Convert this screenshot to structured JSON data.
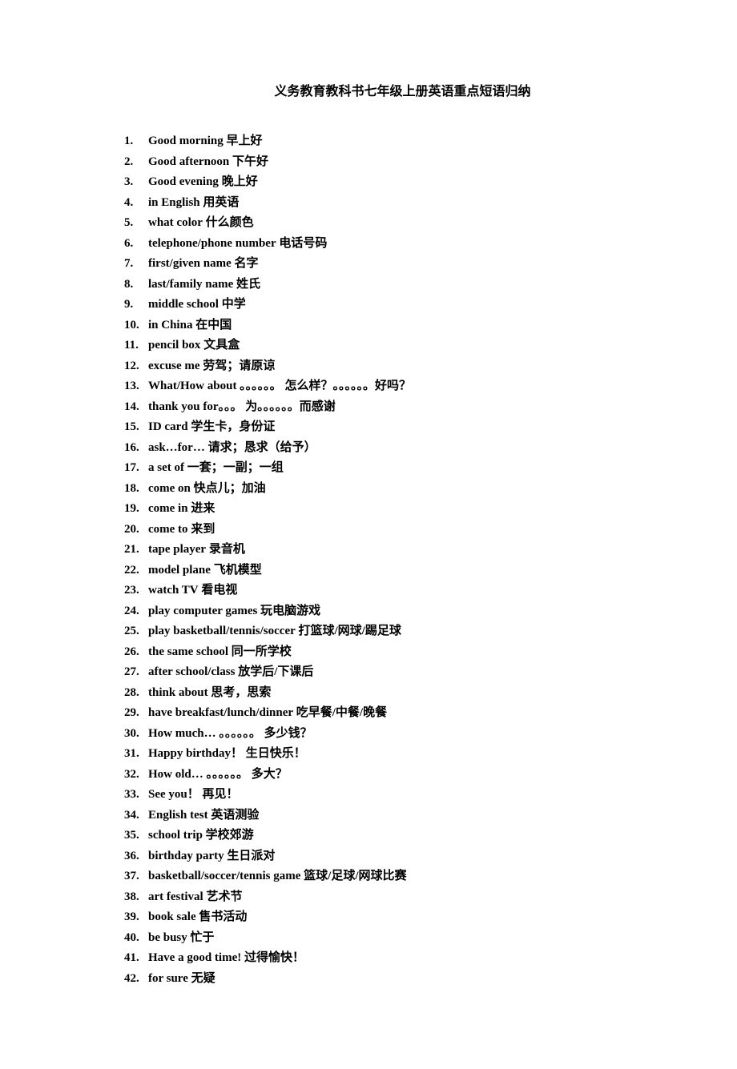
{
  "title": "义务教育教科书七年级上册英语重点短语归纳",
  "items": [
    {
      "en": "Good morning",
      "zh": "早上好"
    },
    {
      "en": "Good afternoon",
      "zh": "下午好"
    },
    {
      "en": "Good evening",
      "zh": "晚上好"
    },
    {
      "en": "in English",
      "zh": "用英语"
    },
    {
      "en": "what color",
      "zh": "什么颜色"
    },
    {
      "en": "telephone/phone number",
      "zh": "电话号码"
    },
    {
      "en": "first/given name",
      "zh": "名字"
    },
    {
      "en": "last/family name",
      "zh": "姓氏"
    },
    {
      "en": "middle school",
      "zh": "中学"
    },
    {
      "en": "in China",
      "zh": "在中国"
    },
    {
      "en": "pencil box",
      "zh": "文具盒"
    },
    {
      "en": "excuse me",
      "zh": "劳驾；请原谅"
    },
    {
      "en": "What/How about 。。。。。。",
      "zh": "怎么样？。。。。。。好吗？"
    },
    {
      "en": "thank you for。。。",
      "zh": "为。。。。。。而感谢"
    },
    {
      "en": "ID card",
      "zh": "学生卡，身份证"
    },
    {
      "en": "ask…for…",
      "zh": "请求；恳求（给予）"
    },
    {
      "en": "a set of",
      "zh": "一套；一副；一组"
    },
    {
      "en": "come on",
      "zh": "快点儿；加油"
    },
    {
      "en": "come in",
      "zh": "进来"
    },
    {
      "en": "come to",
      "zh": "来到"
    },
    {
      "en": "tape player",
      "zh": "录音机"
    },
    {
      "en": "model plane",
      "zh": "飞机模型"
    },
    {
      "en": "watch TV",
      "zh": "看电视"
    },
    {
      "en": "play computer games",
      "zh": "玩电脑游戏"
    },
    {
      "en": "play basketball/tennis/soccer",
      "zh": "打篮球/网球/踢足球"
    },
    {
      "en": "the same school",
      "zh": "同一所学校"
    },
    {
      "en": "after school/class",
      "zh": "放学后/下课后"
    },
    {
      "en": "think about",
      "zh": "思考，思索"
    },
    {
      "en": "have breakfast/lunch/dinner",
      "zh": "吃早餐/中餐/晚餐"
    },
    {
      "en": "How much… 。。。。。。",
      "zh": "多少钱？"
    },
    {
      "en": "Happy birthday！",
      "zh": "生日快乐！"
    },
    {
      "en": "How old… 。。。。。。",
      "zh": "多大？"
    },
    {
      "en": "See you！",
      "zh": "再见！"
    },
    {
      "en": "English test",
      "zh": "英语测验"
    },
    {
      "en": "school trip",
      "zh": "学校郊游"
    },
    {
      "en": "birthday party",
      "zh": "生日派对"
    },
    {
      "en": "basketball/soccer/tennis game",
      "zh": "篮球/足球/网球比赛"
    },
    {
      "en": "art festival",
      "zh": "艺术节"
    },
    {
      "en": "book sale",
      "zh": "售书活动"
    },
    {
      "en": "be busy",
      "zh": "忙于"
    },
    {
      "en": "Have a good time!",
      "zh": "过得愉快！"
    },
    {
      "en": "for sure",
      "zh": "无疑"
    }
  ]
}
